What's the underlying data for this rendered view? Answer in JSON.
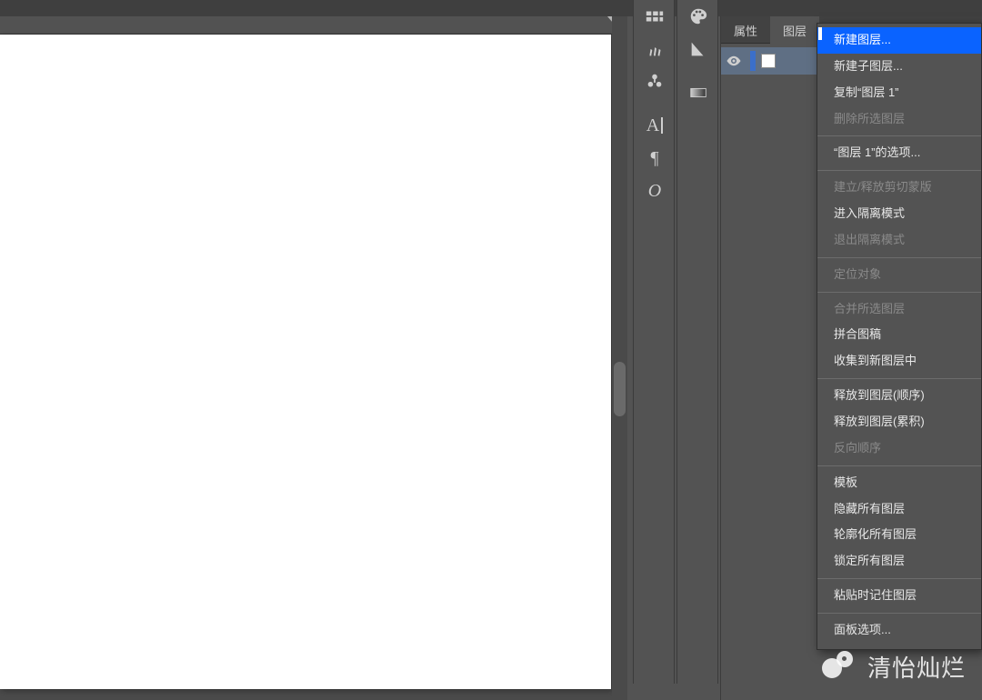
{
  "collapse_glyph": "<<",
  "tabs": {
    "properties": "属性",
    "layers": "图层"
  },
  "layer": {
    "name": "图层 1"
  },
  "menu": {
    "items": [
      {
        "label": "新建图层...",
        "enabled": true,
        "selected": true
      },
      {
        "label": "新建子图层...",
        "enabled": true
      },
      {
        "label": "复制“图层 1”",
        "enabled": true
      },
      {
        "label": "删除所选图层",
        "enabled": false
      },
      {
        "sep": true
      },
      {
        "label": "“图层 1”的选项...",
        "enabled": true
      },
      {
        "sep": true
      },
      {
        "label": "建立/释放剪切蒙版",
        "enabled": false
      },
      {
        "label": "进入隔离模式",
        "enabled": true
      },
      {
        "label": "退出隔离模式",
        "enabled": false
      },
      {
        "sep": true
      },
      {
        "label": "定位对象",
        "enabled": false
      },
      {
        "sep": true
      },
      {
        "label": "合并所选图层",
        "enabled": false
      },
      {
        "label": "拼合图稿",
        "enabled": true
      },
      {
        "label": "收集到新图层中",
        "enabled": true
      },
      {
        "sep": true
      },
      {
        "label": "释放到图层(顺序)",
        "enabled": true
      },
      {
        "label": "释放到图层(累积)",
        "enabled": true
      },
      {
        "label": "反向顺序",
        "enabled": false
      },
      {
        "sep": true
      },
      {
        "label": "模板",
        "enabled": true
      },
      {
        "label": "隐藏所有图层",
        "enabled": true
      },
      {
        "label": "轮廓化所有图层",
        "enabled": true
      },
      {
        "label": "锁定所有图层",
        "enabled": true
      },
      {
        "sep": true
      },
      {
        "label": "粘贴时记住图层",
        "enabled": true
      },
      {
        "sep": true
      },
      {
        "label": "面板选项...",
        "enabled": true
      }
    ]
  },
  "watermark": "清怡灿烂"
}
